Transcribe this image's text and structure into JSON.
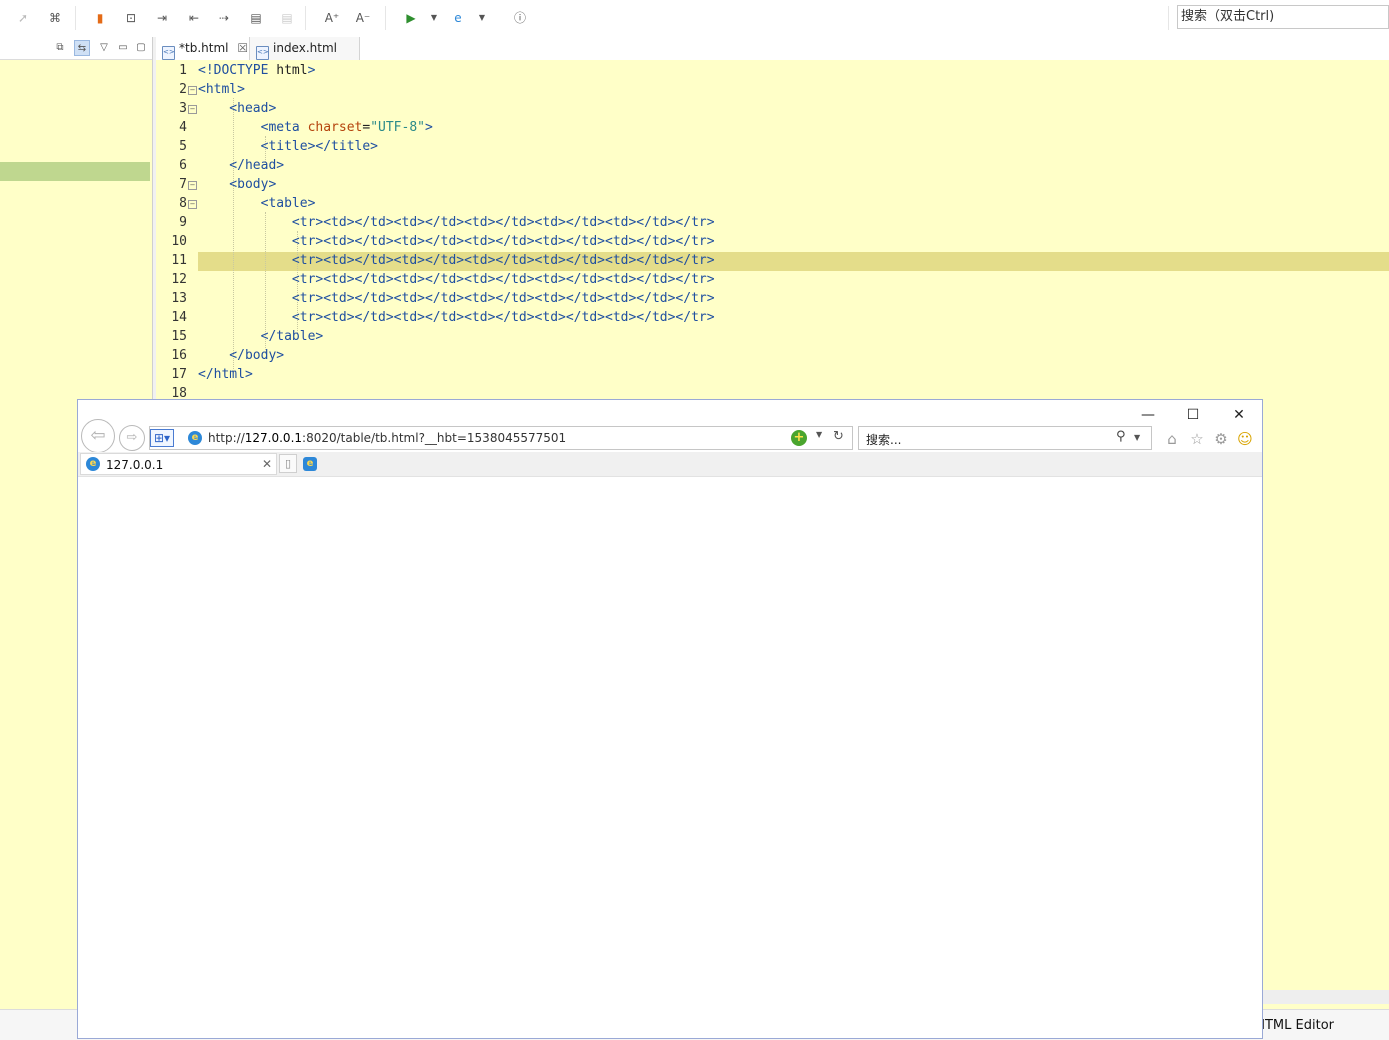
{
  "ide": {
    "search_placeholder": "搜索（双击Ctrl)",
    "tabs": [
      {
        "label": "*tb.html",
        "close": "☒"
      },
      {
        "label": "index.html"
      }
    ],
    "status": "HTML Editor",
    "toolbar_icons": [
      "forward-arrow-icon",
      "history-icon",
      "bookmark-icon",
      "new-file-icon",
      "export-icon",
      "indent-left-icon",
      "indent-right-icon",
      "comment-icon",
      "disabled-icon",
      "font-increase-icon",
      "font-decrease-icon",
      "run-icon",
      "browser-icon",
      "info-icon"
    ],
    "toolbar_glyphs": {
      "font_increase": "A⁺",
      "font_decrease": "A⁻"
    }
  },
  "editor": {
    "line_numbers": [
      "1",
      "2",
      "3",
      "4",
      "5",
      "6",
      "7",
      "8",
      "9",
      "10",
      "11",
      "12",
      "13",
      "14",
      "15",
      "16",
      "17",
      "18"
    ],
    "lines": [
      [
        {
          "t": "<!DOCTYPE ",
          "c": "pl"
        },
        {
          "t": "html",
          "c": "tx"
        },
        {
          "t": ">",
          "c": "pl"
        }
      ],
      [
        {
          "t": "<html>",
          "c": "pl"
        }
      ],
      [
        {
          "t": "    <head>",
          "c": "pl"
        }
      ],
      [
        {
          "t": "        <meta ",
          "c": "pl"
        },
        {
          "t": "charset",
          "c": "at"
        },
        {
          "t": "=",
          "c": "tx"
        },
        {
          "t": "\"UTF-8\"",
          "c": "st"
        },
        {
          "t": ">",
          "c": "pl"
        }
      ],
      [
        {
          "t": "        <title></title>",
          "c": "pl"
        }
      ],
      [
        {
          "t": "    </head>",
          "c": "pl"
        }
      ],
      [
        {
          "t": "    <body>",
          "c": "pl"
        }
      ],
      [
        {
          "t": "        <table>",
          "c": "pl"
        }
      ],
      [
        {
          "t": "            <tr><td></td><td></td><td></td><td></td><td></td></tr>",
          "c": "pl"
        }
      ],
      [
        {
          "t": "            <tr><td></td><td></td><td></td><td></td><td></td></tr>",
          "c": "pl"
        }
      ],
      [
        {
          "t": "            <tr><td></td><td></td><td></td><td></td><td></td></tr>",
          "c": "pl"
        }
      ],
      [
        {
          "t": "            <tr><td></td><td></td><td></td><td></td><td></td></tr>",
          "c": "pl"
        }
      ],
      [
        {
          "t": "            <tr><td></td><td></td><td></td><td></td><td></td></tr>",
          "c": "pl"
        }
      ],
      [
        {
          "t": "            <tr><td></td><td></td><td></td><td></td><td></td></tr>",
          "c": "pl"
        }
      ],
      [
        {
          "t": "        </table>",
          "c": "pl"
        }
      ],
      [
        {
          "t": "    </body>",
          "c": "pl"
        }
      ],
      [
        {
          "t": "</html>",
          "c": "pl"
        }
      ],
      [
        {
          "t": "",
          "c": "pl"
        }
      ]
    ],
    "folded_lines": [
      2,
      3,
      7,
      8
    ],
    "highlighted_line": 11
  },
  "browser": {
    "url_prefix": "http://",
    "url_host": "127.0.0.1",
    "url_rest": ":8020/table/tb.html?__hbt=1538045577501",
    "search_placeholder": "搜索...",
    "tab_title": "127.0.0.1",
    "tab_close": "✕",
    "window_buttons": {
      "minimize": "—",
      "maximize": "☐",
      "close": "✕"
    },
    "icons": [
      "back-icon",
      "forward-icon",
      "compat-view-icon",
      "ie-icon",
      "add-on-icon",
      "refresh-icon",
      "search-icon",
      "home-icon",
      "favorites-star-icon",
      "settings-gear-icon",
      "smiley-feedback-icon"
    ]
  },
  "colors": {
    "editor_bg": "#ffffc8",
    "highlight": "#e4dd8a",
    "selection": "#bfd78f"
  }
}
